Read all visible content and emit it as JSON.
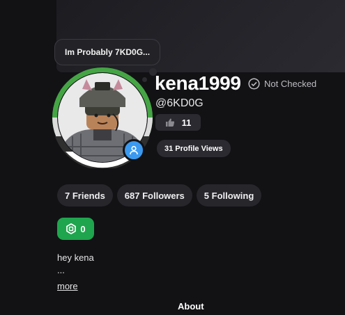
{
  "tooltip": {
    "text": "Im Probably 7KD0G..."
  },
  "profile": {
    "username": "kena1999",
    "verification_status": "Not Checked",
    "handle": "@6KD0G",
    "likes_count": "11",
    "profile_views": "31 Profile Views",
    "badge_icon": "user-icon",
    "ring_colors": [
      "#45a545",
      "#dcdcdc",
      "#2f2f2f",
      "#ffffff"
    ]
  },
  "stats": [
    {
      "label": "7 Friends"
    },
    {
      "label": "687 Followers"
    },
    {
      "label": "5 Following"
    }
  ],
  "robux": {
    "amount": "0",
    "color": "#1fa54d"
  },
  "bio": {
    "line1": "hey kena",
    "line2": "...",
    "more_label": "more"
  },
  "section": {
    "about_label": "About"
  }
}
